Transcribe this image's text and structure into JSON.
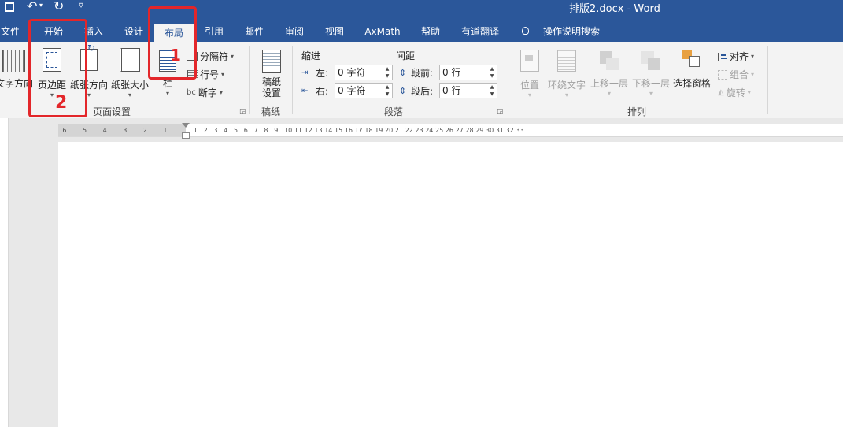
{
  "window": {
    "title": "排版2.docx  -  Word"
  },
  "qat": {
    "undo_glyph": "↶",
    "redo_glyph": "↻",
    "more_glyph": "▿"
  },
  "tabs": [
    {
      "label": "文件"
    },
    {
      "label": "开始"
    },
    {
      "label": "插入"
    },
    {
      "label": "设计"
    },
    {
      "label": "布局"
    },
    {
      "label": "引用"
    },
    {
      "label": "邮件"
    },
    {
      "label": "审阅"
    },
    {
      "label": "视图"
    },
    {
      "label": "AxMath"
    },
    {
      "label": "帮助"
    },
    {
      "label": "有道翻译"
    },
    {
      "label": "操作说明搜索"
    }
  ],
  "page_setup": {
    "group_label": "页面设置",
    "text_direction": "文字方向",
    "margins": "页边距",
    "orientation": "纸张方向",
    "size": "纸张大小",
    "columns": "栏",
    "breaks": "分隔符",
    "line_numbers": "行号",
    "hyphenation": "断字"
  },
  "manuscript": {
    "group_label": "稿纸",
    "button_line1": "稿纸",
    "button_line2": "设置"
  },
  "paragraph": {
    "group_label": "段落",
    "indent_header": "缩进",
    "spacing_header": "间距",
    "left_label": "左:",
    "right_label": "右:",
    "before_label": "段前:",
    "after_label": "段后:",
    "left_value": "0 字符",
    "right_value": "0 字符",
    "before_value": "0 行",
    "after_value": "0 行"
  },
  "arrange": {
    "group_label": "排列",
    "position": "位置",
    "wrap_text": "环绕文字",
    "bring_forward": "上移一层",
    "send_backward": "下移一层",
    "selection_pane": "选择窗格",
    "align": "对齐",
    "group": "组合",
    "rotate": "旋转"
  },
  "ruler": {
    "left_ticks": [
      "6",
      "5",
      "4",
      "3",
      "2",
      "1"
    ],
    "right_ticks": [
      "2",
      "4",
      "6",
      "8",
      "10",
      "12",
      "14",
      "16",
      "18",
      "20",
      "22",
      "24",
      "26",
      "28",
      "30",
      "32"
    ],
    "odd_ticks": [
      "1",
      "3",
      "5",
      "7",
      "9",
      "11",
      "13",
      "15",
      "17",
      "19",
      "21",
      "23",
      "25",
      "27",
      "29",
      "31",
      "33"
    ]
  },
  "annotations": {
    "one": "1",
    "two": "2"
  },
  "colors": {
    "brand": "#2b579a",
    "annotation": "#e3262a"
  }
}
